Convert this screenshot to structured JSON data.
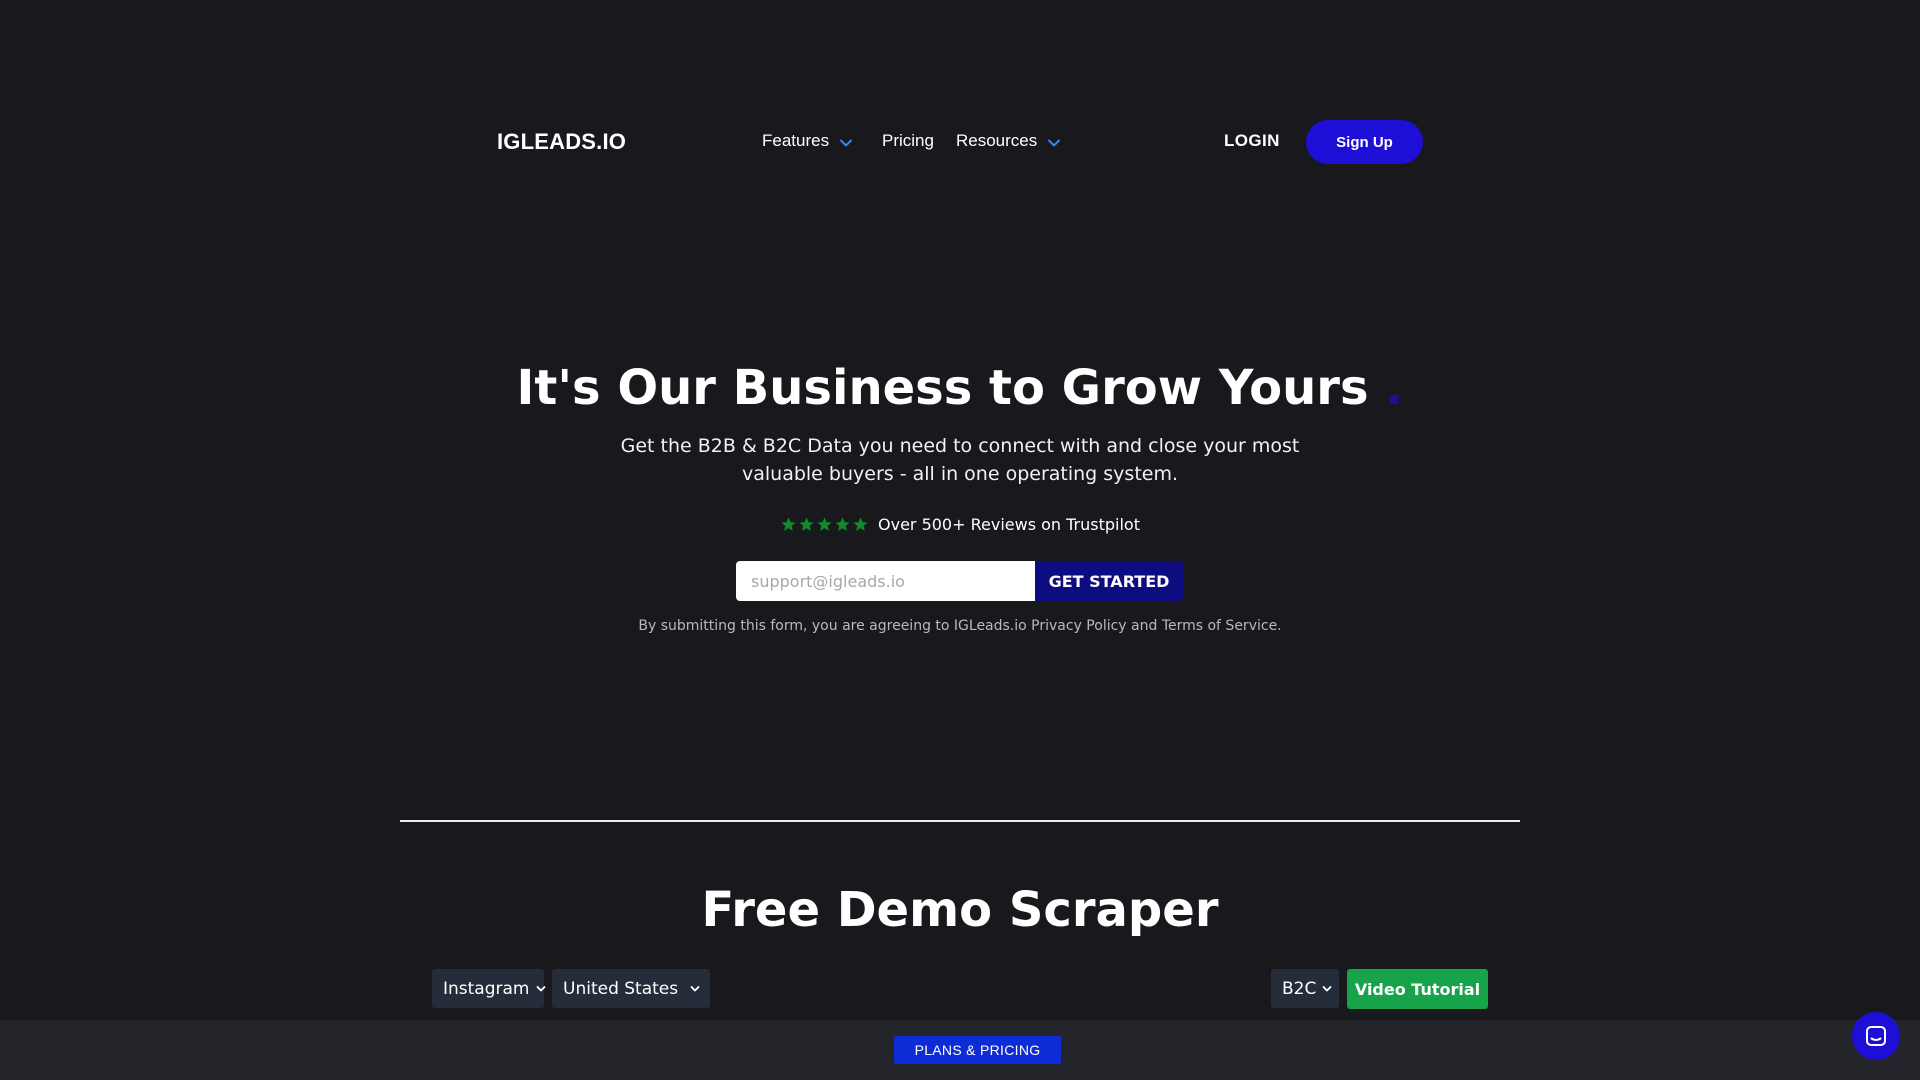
{
  "nav": {
    "logo": "IGLEADS.IO",
    "items": [
      {
        "label": "Features",
        "icon": "chevron-down-icon"
      },
      {
        "label": "Pricing"
      },
      {
        "label": "Resources",
        "icon": "chevron-down-icon"
      }
    ],
    "login_label": "LOGIN",
    "signup_label": "Sign Up"
  },
  "hero": {
    "title": "It's Our Business to Grow Yours",
    "title_dot": ".",
    "subtitle": "Get the B2B & B2C Data you need to connect with and close your most valuable buyers - all in one operating system.",
    "rating_stars": 5,
    "reviews_text": "Over 500+ Reviews on Trustpilot",
    "email_placeholder": "support@igleads.io",
    "cta_label": "GET STARTED",
    "legal_text": "By submitting this form, you are agreeing to IGLeads.io Privacy Policy and Terms of Service."
  },
  "demo": {
    "title": "Free Demo Scraper",
    "platform_selected": "Instagram",
    "country_selected": "United States",
    "type_selected": "B2C",
    "video_label": "Video Tutorial"
  },
  "bottom_bar": {
    "plans_label": "PLANS & PRICING"
  },
  "colors": {
    "background": "#18181d",
    "accent": "#1e0fd6",
    "cta_dark": "#0d0c80",
    "trustpilot_green": "#0f8a2c",
    "video_green": "#16a34a",
    "select_bg": "#262d3a",
    "plans_blue": "#0e2cd6"
  }
}
